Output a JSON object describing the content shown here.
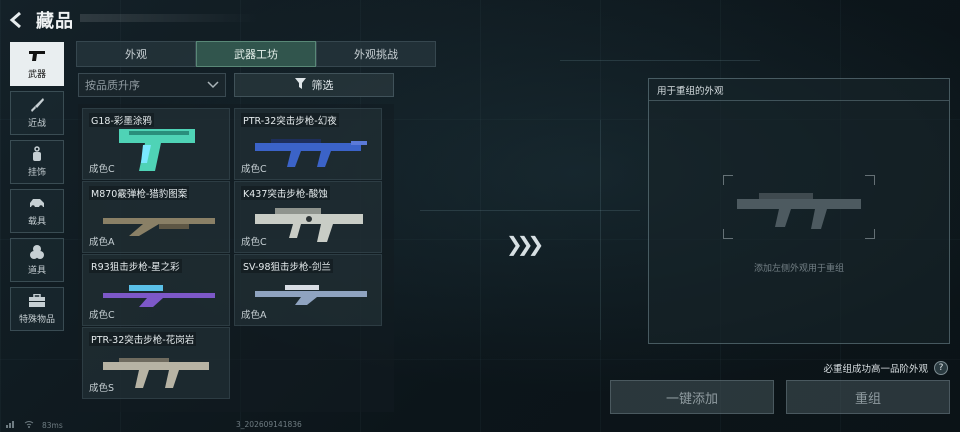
{
  "header": {
    "title": "藏品"
  },
  "sidebar": {
    "items": [
      {
        "label": "武器",
        "icon": "pistol-icon",
        "active": true
      },
      {
        "label": "近战",
        "icon": "knife-icon",
        "active": false
      },
      {
        "label": "挂饰",
        "icon": "charm-icon",
        "active": false
      },
      {
        "label": "载具",
        "icon": "car-icon",
        "active": false
      },
      {
        "label": "道具",
        "icon": "grenade-icon",
        "active": false
      },
      {
        "label": "特殊物品",
        "icon": "case-icon",
        "active": false
      }
    ]
  },
  "tabs": [
    {
      "label": "外观",
      "active": false
    },
    {
      "label": "武器工坊",
      "active": true
    },
    {
      "label": "外观挑战",
      "active": false
    }
  ],
  "sort": {
    "value": "按品质升序"
  },
  "filter": {
    "label": "筛选"
  },
  "skins": [
    {
      "name": "G18-彩墨涂鸦",
      "grade": "成色C",
      "color": "#4fd3b6"
    },
    {
      "name": "PTR-32突击步枪-幻夜",
      "grade": "成色C",
      "color": "#3b63c8"
    },
    {
      "name": "M870霰弹枪-猎豹图案",
      "grade": "成色A",
      "color": "#8a8066"
    },
    {
      "name": "K437突击步枪-酸蚀",
      "grade": "成色C",
      "color": "#c9cdc6"
    },
    {
      "name": "R93狙击步枪-星之彩",
      "grade": "成色C",
      "color": "#7d58c8"
    },
    {
      "name": "SV-98狙击步枪-剑兰",
      "grade": "成色A",
      "color": "#8fa3c0"
    },
    {
      "name": "PTR-32突击步枪-花岗岩",
      "grade": "成色S",
      "color": "#b7b3a4"
    }
  ],
  "panel": {
    "title": "用于重组的外观",
    "hint": "添加左侧外观用于重组"
  },
  "note": {
    "text": "必重组成功高一品阶外观",
    "help": "?"
  },
  "buttons": {
    "quick_add": "一键添加",
    "recompose": "重组"
  },
  "status": {
    "ping": "83ms",
    "uid_suffix": "3_202609141836"
  }
}
